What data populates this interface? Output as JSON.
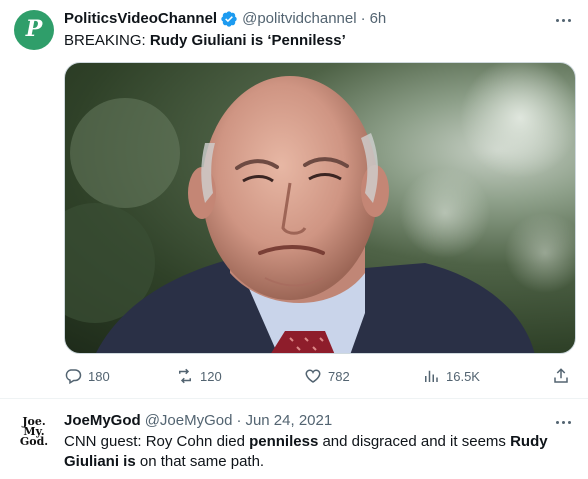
{
  "tweet1": {
    "avatar_letter": "P",
    "name": "PoliticsVideoChannel",
    "handle": "@politvidchannel",
    "separator": "·",
    "time": "6h",
    "text_prefix": "BREAKING: ",
    "text_bold": "Rudy Giuliani is ‘Penniless’",
    "media_icon": "photo",
    "stats": {
      "replies": "180",
      "retweets": "120",
      "likes": "782",
      "views": "16.5K"
    }
  },
  "tweet2": {
    "avatar_lines": [
      "Joe.",
      "My.",
      "God."
    ],
    "name": "JoeMyGod",
    "handle": "@JoeMyGod",
    "separator": "·",
    "time": "Jun 24, 2021",
    "text_parts": {
      "p1": "CNN guest: Roy Cohn died ",
      "b1": "penniless",
      "p2": " and disgraced and it seems ",
      "b2": "Rudy Giuliani is",
      "p3": " on that same path."
    }
  },
  "colors": {
    "verified": "#1d9bf0",
    "secondary_text": "#536471",
    "avatar_bg": "#2f9e6a"
  }
}
